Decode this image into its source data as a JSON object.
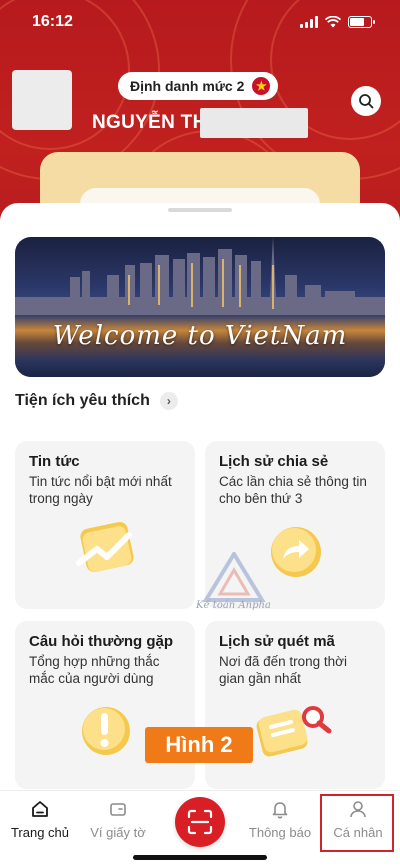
{
  "status_bar": {
    "time": "16:12"
  },
  "header": {
    "id_level_label": "Định danh mức 2",
    "user_name": "NGUYỄN TH"
  },
  "banner": {
    "caption": "Welcome to VietNam"
  },
  "favorites": {
    "title": "Tiện ích yêu thích",
    "tiles": [
      {
        "title": "Tin tức",
        "description": "Tin tức nổi bật mới nhất trong ngày"
      },
      {
        "title": "Lịch sử chia sẻ",
        "description": "Các lần chia sẻ thông tin cho bên thứ 3"
      },
      {
        "title": "Câu hỏi thường gặp",
        "description": "Tổng hợp những thắc mắc của người dùng"
      },
      {
        "title": "Lịch sử quét mã",
        "description": "Nơi đã đến trong thời gian gần nhất"
      }
    ]
  },
  "watermark": {
    "text": "Kế toán Anpha"
  },
  "annotation": {
    "label": "Hình 2"
  },
  "bottom_nav": {
    "items": [
      {
        "label": "Trang chủ"
      },
      {
        "label": "Ví giấy tờ"
      },
      {
        "label": "Thông báo"
      },
      {
        "label": "Cá nhân"
      }
    ]
  },
  "colors": {
    "header_red": "#b71a1e",
    "scan_red": "#d81f26",
    "card_gold": "#f5dca4",
    "annotation_orange": "#f07a17",
    "highlight_red": "#d1232a"
  }
}
